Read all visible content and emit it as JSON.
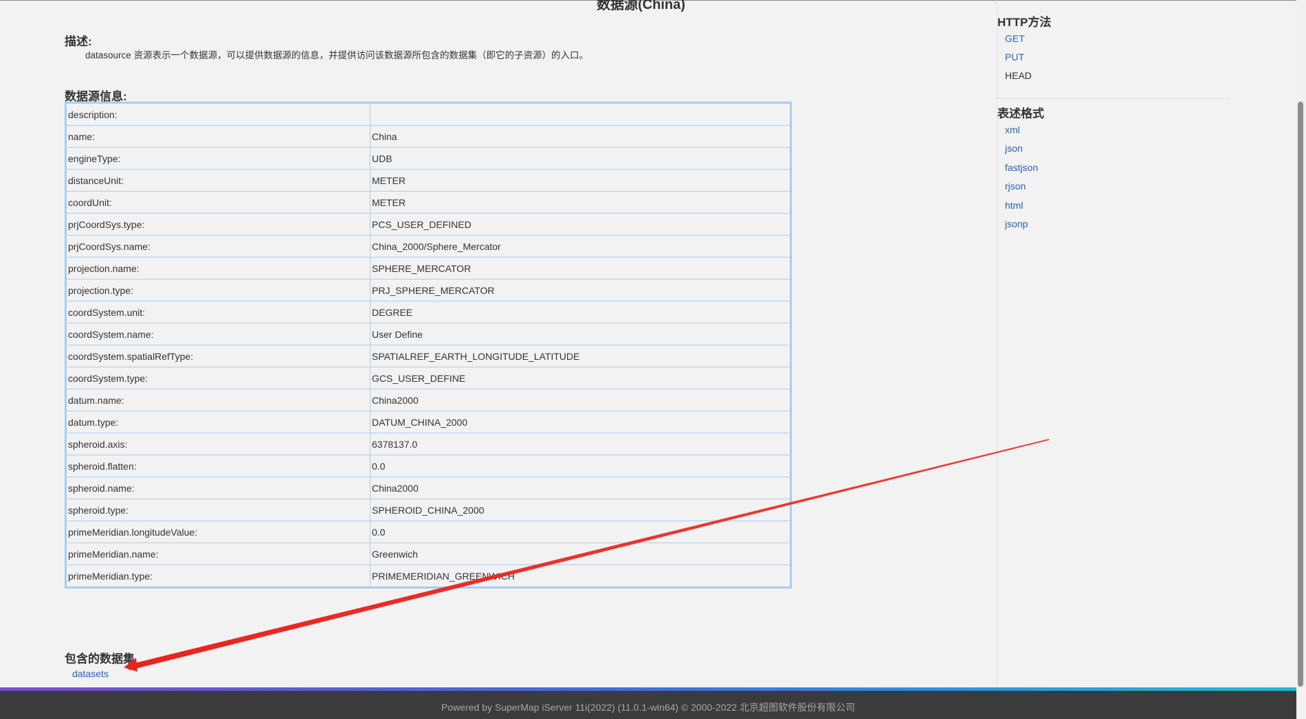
{
  "page": {
    "title": "数据源(China)"
  },
  "description": {
    "heading": "描述:",
    "text": "datasource 资源表示一个数据源，可以提供数据源的信息，并提供访问该数据源所包含的数据集（即它的子资源）的入口。"
  },
  "datasource_info": {
    "heading": "数据源信息:",
    "rows": [
      {
        "key": "description:",
        "value": ""
      },
      {
        "key": "name:",
        "value": "China"
      },
      {
        "key": "engineType:",
        "value": "UDB"
      },
      {
        "key": "distanceUnit:",
        "value": "METER"
      },
      {
        "key": "coordUnit:",
        "value": "METER"
      },
      {
        "key": "prjCoordSys.type:",
        "value": "PCS_USER_DEFINED"
      },
      {
        "key": "prjCoordSys.name:",
        "value": "China_2000/Sphere_Mercator"
      },
      {
        "key": "projection.name:",
        "value": "SPHERE_MERCATOR"
      },
      {
        "key": "projection.type:",
        "value": "PRJ_SPHERE_MERCATOR"
      },
      {
        "key": "coordSystem.unit:",
        "value": "DEGREE"
      },
      {
        "key": "coordSystem.name:",
        "value": "User Define"
      },
      {
        "key": "coordSystem.spatialRefType:",
        "value": "SPATIALREF_EARTH_LONGITUDE_LATITUDE"
      },
      {
        "key": "coordSystem.type:",
        "value": "GCS_USER_DEFINE"
      },
      {
        "key": "datum.name:",
        "value": "China2000"
      },
      {
        "key": "datum.type:",
        "value": "DATUM_CHINA_2000"
      },
      {
        "key": "spheroid.axis:",
        "value": "6378137.0"
      },
      {
        "key": "spheroid.flatten:",
        "value": "0.0"
      },
      {
        "key": "spheroid.name:",
        "value": "China2000"
      },
      {
        "key": "spheroid.type:",
        "value": "SPHEROID_CHINA_2000"
      },
      {
        "key": "primeMeridian.longitudeValue:",
        "value": "0.0"
      },
      {
        "key": "primeMeridian.name:",
        "value": "Greenwich"
      },
      {
        "key": "primeMeridian.type:",
        "value": "PRIMEMERIDIAN_GREENWICH"
      }
    ]
  },
  "datasets": {
    "heading": "包含的数据集",
    "link_label": "datasets"
  },
  "sidebar": {
    "http_methods": {
      "heading": "HTTP方法",
      "items": [
        {
          "label": "GET",
          "link": true
        },
        {
          "label": "PUT",
          "link": true
        },
        {
          "label": "HEAD",
          "link": false
        }
      ]
    },
    "formats": {
      "heading": "表述格式",
      "items": [
        "xml",
        "json",
        "fastjson",
        "rjson",
        "html",
        "jsonp"
      ]
    }
  },
  "footer": {
    "text": "Powered by SuperMap iServer 11i(2022) (11.0.1-win64) © 2000-2022 北京超图软件股份有限公司"
  },
  "colors": {
    "link": "#2961b8",
    "table_border": "#a7cdf0",
    "annotation_arrow": "#e8231c",
    "footer_bg": "#3b3b3b"
  }
}
